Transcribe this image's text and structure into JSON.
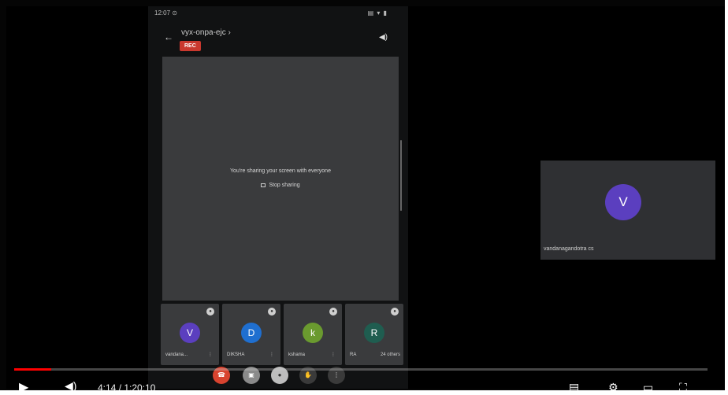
{
  "status_bar": {
    "time": "12:07 ⊙",
    "icons": "▤ ▾ ▮"
  },
  "meet": {
    "meeting_code": "vyx-onpa-ejc ›",
    "rec_label": "REC",
    "share_message": "You're sharing your screen with everyone",
    "stop_sharing_label": "Stop sharing"
  },
  "tiles": [
    {
      "initial": "V",
      "name": "vandana...",
      "color": "#5b3fbf"
    },
    {
      "initial": "D",
      "name": "DIKSHA",
      "color": "#1f6fd0"
    },
    {
      "initial": "k",
      "name": "kshama",
      "color": "#6a9a2f"
    },
    {
      "initial": "R",
      "name": "RA",
      "extra": "24 others",
      "color": "#1f5d50"
    }
  ],
  "participant": {
    "initial": "V",
    "name": "vandanagandotra cs"
  },
  "player": {
    "time": "4:14 / 1:20:10",
    "progress_percent": 5.3
  },
  "icons": {
    "back": "arrow-left-icon",
    "speaker": "speaker-icon",
    "play": "play-icon",
    "volume": "volume-icon",
    "mic": "mic-icon"
  }
}
